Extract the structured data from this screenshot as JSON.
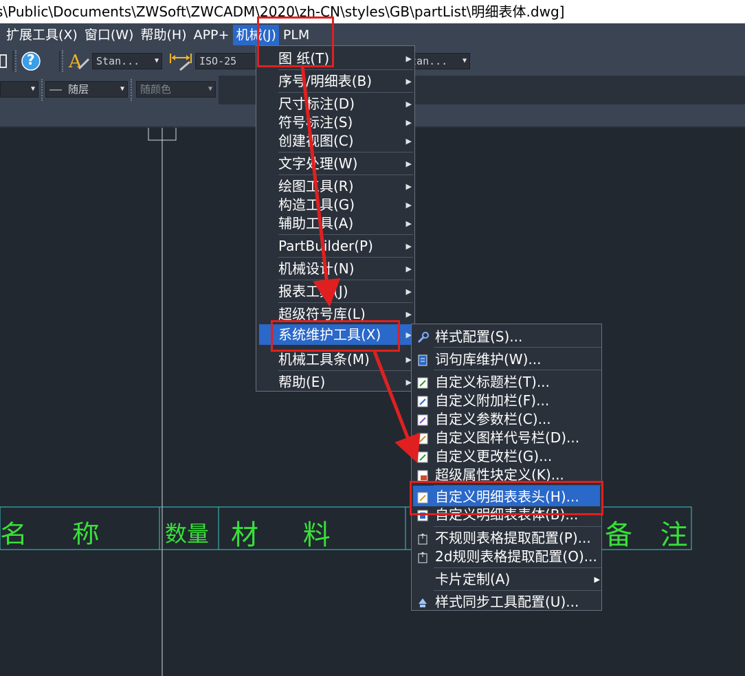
{
  "title_bar": {
    "text": "s\\Public\\Documents\\ZWSoft\\ZWCADM\\2020\\zh-CN\\styles\\GB\\partList\\明细表体.dwg]"
  },
  "menubar": {
    "items": [
      "扩展工具(X)",
      "窗口(W)",
      "帮助(H)",
      "APP+",
      "机械(J)",
      "PLM"
    ],
    "active": "机械(J)"
  },
  "toolbar": {
    "text_style": "Stan...",
    "dim_style": "ISO-25",
    "table_style": "Stan...",
    "linetype": "—— 随层",
    "color": "随颜色",
    "help_label": "?"
  },
  "menu_jixie": {
    "items": [
      "图    纸(T)",
      "序号/明细表(B)",
      "尺寸标注(D)",
      "符号标注(S)",
      "创建视图(C)",
      "文字处理(W)",
      "绘图工具(R)",
      "构造工具(G)",
      "辅助工具(A)",
      "PartBuilder(P)",
      "机械设计(N)",
      "报表工具(J)",
      "超级符号库(L)",
      "系统维护工具(X)",
      "机械工具条(M)",
      "帮助(E)"
    ],
    "highlighted": "系统维护工具(X)"
  },
  "menu_sysmaint": {
    "items": [
      "样式配置(S)...",
      "词句库维护(W)...",
      "自定义标题栏(T)...",
      "自定义附加栏(F)...",
      "自定义参数栏(C)...",
      "自定义图样代号栏(D)...",
      "自定义更改栏(G)...",
      "超级属性块定义(K)...",
      "自定义明细表表头(H)...",
      "自定义明细表表体(B)...",
      "不规则表格提取配置(P)...",
      "2d规则表格提取配置(O)...",
      "卡片定制(A)",
      "样式同步工具配置(U)..."
    ],
    "highlighted": "自定义明细表表头(H)..."
  },
  "drawing_table": {
    "cells": [
      "名 称",
      "数量",
      "材 料",
      "备 注"
    ]
  },
  "colors": {
    "accent": "#2a68c9",
    "annotation": "#e02020",
    "cad_green": "#38e038",
    "cad_cyan": "#40c8c8"
  }
}
